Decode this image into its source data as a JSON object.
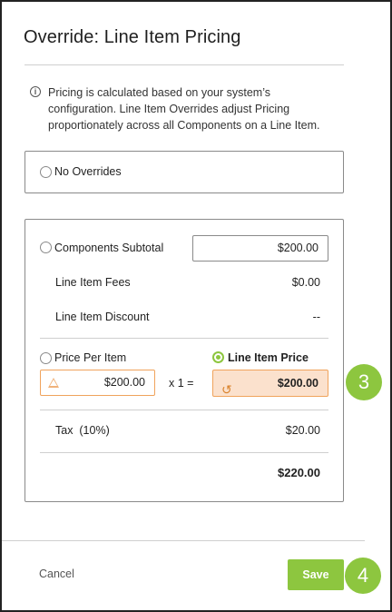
{
  "dialog": {
    "title": "Override: Line Item Pricing",
    "info_text": "Pricing is calculated based on your system’s configuration. Line Item Overrides adjust Pricing proportionately across all Components on a Line Item."
  },
  "no_overrides": {
    "label": "No Overrides",
    "selected": false
  },
  "pricing": {
    "components_subtotal": {
      "label": "Components Subtotal",
      "value": "$200.00",
      "selected": false
    },
    "line_item_fees": {
      "label": "Line Item Fees",
      "value": "$0.00"
    },
    "line_item_discount": {
      "label": "Line Item Discount",
      "value": "--"
    },
    "price_per_item": {
      "label": "Price Per Item",
      "value": "$200.00",
      "selected": false
    },
    "multiplier": "x 1 =",
    "line_item_price": {
      "label": "Line Item Price",
      "value": "$200.00",
      "selected": true
    },
    "tax": {
      "label": "Tax  (10%)",
      "value": "$20.00"
    },
    "total": {
      "value": "$220.00"
    }
  },
  "footer": {
    "cancel_label": "Cancel",
    "save_label": "Save"
  },
  "callouts": {
    "step3": "3",
    "step4": "4"
  },
  "colors": {
    "accent": "#8dc63f",
    "override_bg": "#fbe1cd",
    "warning": "#f0a35c"
  }
}
